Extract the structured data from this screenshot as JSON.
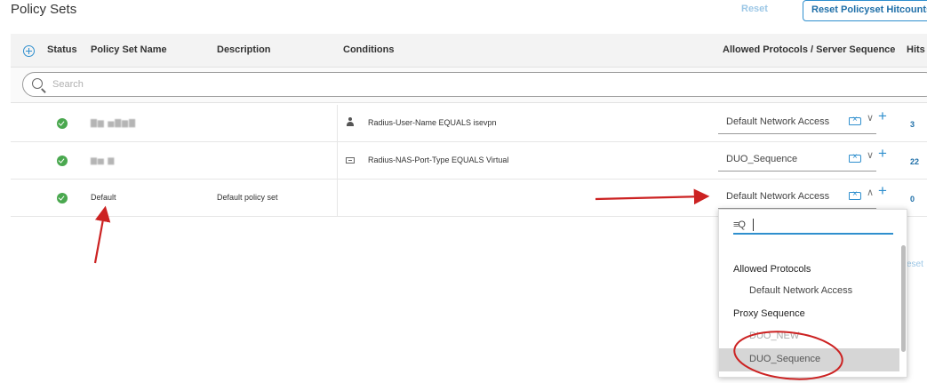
{
  "page": {
    "title": "Policy Sets",
    "reset_label": "Reset",
    "reset_hits_label": "Reset Policyset Hitcounts",
    "side_reset": "eset"
  },
  "table": {
    "headers": {
      "status": "Status",
      "name": "Policy Set Name",
      "description": "Description",
      "conditions": "Conditions",
      "protocols": "Allowed Protocols / Server Sequence",
      "hits": "Hits"
    },
    "search": {
      "placeholder": "Search"
    },
    "rows": [
      {
        "name": "▇▆ ▅▇▆▇",
        "description": "",
        "condition_icon": "user-icon",
        "condition": "Radius-User-Name  EQUALS  isevpn",
        "protocol": "Default Network Access",
        "chevron": "∨",
        "hits": "3"
      },
      {
        "name": "▆▅  ▆",
        "description": "",
        "condition_icon": "port-icon",
        "condition": "Radius-NAS-Port-Type  EQUALS  Virtual",
        "protocol": "DUO_Sequence",
        "chevron": "∨",
        "hits": "22"
      },
      {
        "name": "Default",
        "description": "Default policy set",
        "condition_icon": "",
        "condition": "",
        "protocol": "Default Network Access",
        "chevron": "∧",
        "hits": "0"
      }
    ]
  },
  "dropdown": {
    "search_value": "",
    "groups": [
      {
        "label": "Allowed Protocols",
        "items": [
          {
            "label": "Default Network Access"
          }
        ]
      },
      {
        "label": "Proxy Sequence",
        "items": [
          {
            "label": "DUO_NEW"
          },
          {
            "label": "DUO_Sequence"
          }
        ]
      }
    ]
  },
  "colors": {
    "accent": "#2f8fce",
    "status_ok": "#4aa84f",
    "annotation": "#cc2222",
    "hover": "#d6d6d6"
  }
}
